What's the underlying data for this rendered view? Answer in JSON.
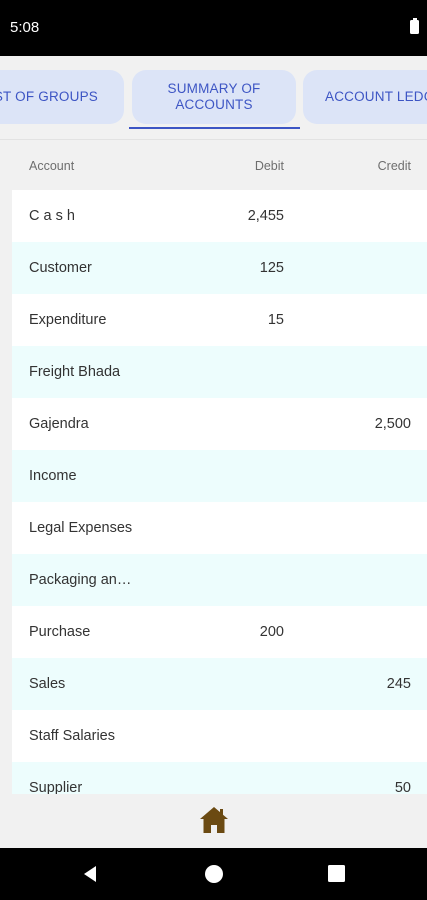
{
  "status_bar": {
    "time": "5:08"
  },
  "tabs": [
    {
      "label": "ST OF GROUPS"
    },
    {
      "label": "SUMMARY OF ACCOUNTS"
    },
    {
      "label": "ACCOUNT LEDG"
    }
  ],
  "table": {
    "headers": {
      "account": "Account",
      "debit": "Debit",
      "credit": "Credit"
    },
    "rows": [
      {
        "account": "C a s h",
        "debit": "2,455",
        "credit": ""
      },
      {
        "account": "Customer",
        "debit": "125",
        "credit": ""
      },
      {
        "account": "Expenditure",
        "debit": "15",
        "credit": ""
      },
      {
        "account": "Freight Bhada",
        "debit": "",
        "credit": ""
      },
      {
        "account": "Gajendra",
        "debit": "",
        "credit": "2,500"
      },
      {
        "account": "Income",
        "debit": "",
        "credit": ""
      },
      {
        "account": "Legal Expenses",
        "debit": "",
        "credit": ""
      },
      {
        "account": "Packaging an…",
        "debit": "",
        "credit": ""
      },
      {
        "account": "Purchase",
        "debit": "200",
        "credit": ""
      },
      {
        "account": "Sales",
        "debit": "",
        "credit": "245"
      },
      {
        "account": "Staff Salaries",
        "debit": "",
        "credit": ""
      },
      {
        "account": "Supplier",
        "debit": "",
        "credit": "50"
      }
    ]
  },
  "bottom_bar": {
    "icon": "home-icon",
    "icon_color": "#6b4a12"
  },
  "colors": {
    "tab_bg": "#dce4f7",
    "tab_text": "#3d55c4",
    "row_alt": "#edfdfd",
    "row_plain": "#ffffff",
    "page_bg": "#f1f1f1"
  }
}
